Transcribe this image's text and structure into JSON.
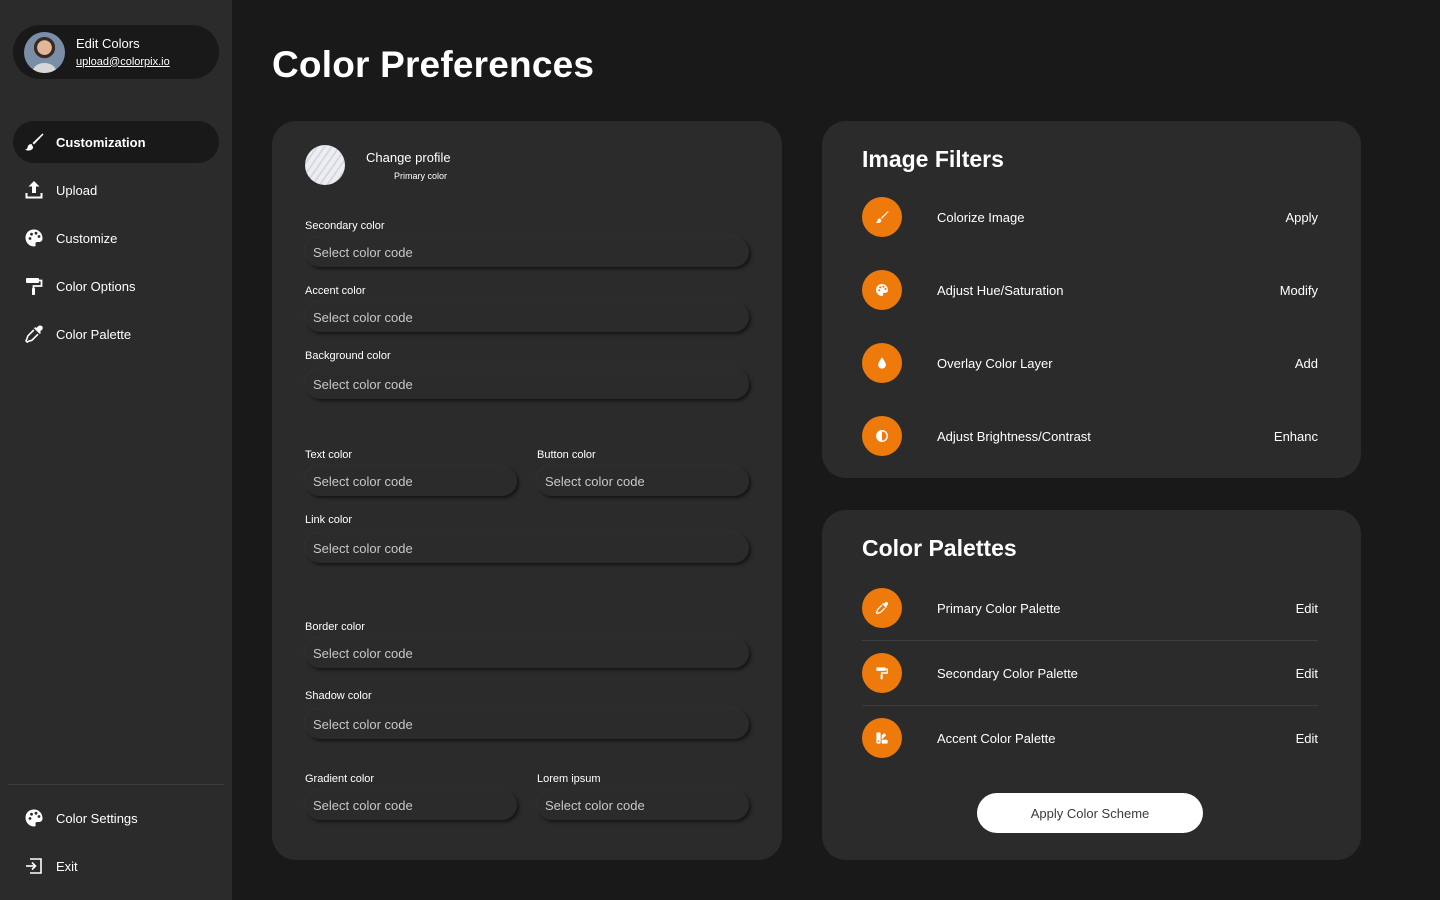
{
  "profile": {
    "name": "Edit Colors",
    "email": "upload@colorpix.io"
  },
  "sidebar": {
    "items": [
      {
        "label": "Customization",
        "icon": "brush-icon",
        "active": true
      },
      {
        "label": "Upload",
        "icon": "upload-icon"
      },
      {
        "label": "Customize",
        "icon": "palette-icon"
      },
      {
        "label": "Color Options",
        "icon": "paint-roller-icon"
      },
      {
        "label": "Color Palette",
        "icon": "eyedropper-icon"
      }
    ],
    "bottom": [
      {
        "label": "Color Settings",
        "icon": "palette-icon"
      },
      {
        "label": "Exit",
        "icon": "exit-icon"
      }
    ]
  },
  "page": {
    "title": "Color Preferences"
  },
  "form": {
    "change_profile": "Change profile",
    "primary_color": "Primary color",
    "fields": [
      {
        "label": "Secondary color",
        "placeholder": "Select color code"
      },
      {
        "label": "Accent color",
        "placeholder": "Select color code"
      },
      {
        "label": "Background color",
        "placeholder": "Select color code"
      },
      {
        "label": "Text color",
        "placeholder": "Select color code"
      },
      {
        "label": "Button color",
        "placeholder": "Select color code"
      },
      {
        "label": "Link color",
        "placeholder": "Select color code"
      },
      {
        "label": "Border color",
        "placeholder": "Select color code"
      },
      {
        "label": "Shadow color",
        "placeholder": "Select color code"
      },
      {
        "label": "Gradient color",
        "placeholder": "Select color code"
      },
      {
        "label": "Lorem ipsum",
        "placeholder": "Select color code"
      }
    ]
  },
  "filters": {
    "title": "Image Filters",
    "items": [
      {
        "label": "Colorize Image",
        "action": "Apply",
        "icon": "brush-icon"
      },
      {
        "label": "Adjust Hue/Saturation",
        "action": "Modify",
        "icon": "palette-icon"
      },
      {
        "label": "Overlay Color Layer",
        "action": "Add",
        "icon": "droplet-icon"
      },
      {
        "label": "Adjust Brightness/Contrast",
        "action": "Enhanc",
        "icon": "contrast-icon"
      }
    ]
  },
  "palettes": {
    "title": "Color Palettes",
    "items": [
      {
        "label": "Primary Color Palette",
        "action": "Edit",
        "icon": "eyedropper-icon"
      },
      {
        "label": "Secondary Color Palette",
        "action": "Edit",
        "icon": "paint-roller-icon"
      },
      {
        "label": "Accent Color Palette",
        "action": "Edit",
        "icon": "swatches-icon"
      }
    ],
    "apply_button": "Apply Color Scheme"
  },
  "colors": {
    "accent": "#ee7a0c",
    "background": "#191919",
    "card": "#2b2b2b",
    "text": "#ffffff"
  }
}
